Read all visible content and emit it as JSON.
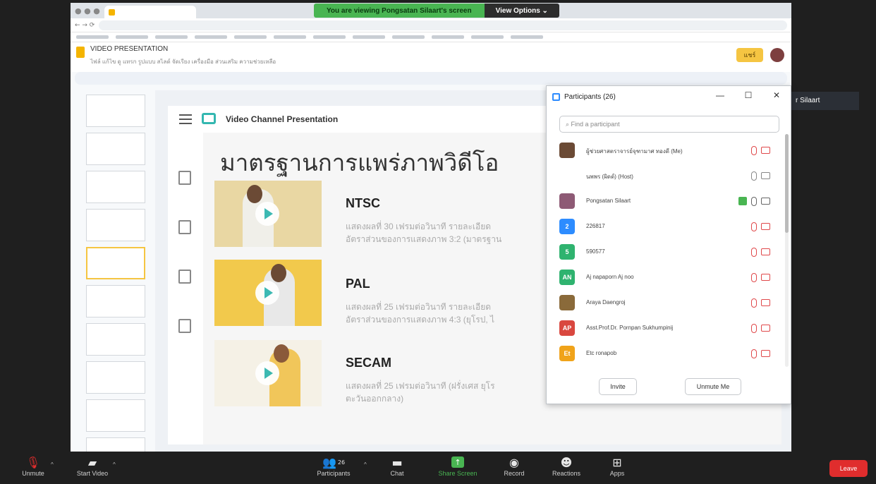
{
  "banner": {
    "sharing_text": "You are viewing Pongsatan Silaart's screen",
    "view_options": "View Options ⌄"
  },
  "doc": {
    "title": "VIDEO PRESENTATION",
    "menus": "ไฟล์  แก้ไข  ดู  แทรก  รูปแบบ  สไลด์  จัดเรียง  เครื่องมือ  ส่วนเสริม  ความช่วยเหลือ",
    "share_label": "แชร์"
  },
  "slide": {
    "channel_title": "Video Channel Presentation",
    "heading": "มาตรฐานการแพร่ภาพวิดีโอ",
    "standards": [
      {
        "name": "NTSC",
        "line1": "แสดงผลที่ 30 เฟรมต่อวินาที รายละเอียด",
        "line2": "อัตราส่วนของการแสดงภาพ 3:2 (มาตรฐาน"
      },
      {
        "name": "PAL",
        "line1": "แสดงผลที่ 25 เฟรมต่อวินาที รายละเอียด",
        "line2": "อัตราส่วนของการแสดงภาพ 4:3 (ยุโรป, ไ"
      },
      {
        "name": "SECAM",
        "line1": "แสดงผลที่ 25 เฟรมต่อวินาที (ฝรั่งเศส ยุโร",
        "line2": "ตะวันออกกลาง)"
      }
    ]
  },
  "participants": {
    "title": "Participants (26)",
    "search_placeholder": "Find a participant",
    "list": [
      {
        "name": "ผู้ช่วยศาสตราจารย์จุฑามาศ ทองดี (Me)",
        "color": "#6b4a35",
        "initials": ""
      },
      {
        "name": "นพพร (ผิดด์) (Host)",
        "color": "#ffffff",
        "initials": ""
      },
      {
        "name": "Pongsatan Silaart",
        "color": "#8e5a75",
        "initials": ""
      },
      {
        "name": "226817",
        "color": "#2d8cff",
        "initials": "2"
      },
      {
        "name": "590577",
        "color": "#2fb36f",
        "initials": "5"
      },
      {
        "name": "Aj napaporn Aj noo",
        "color": "#2fb36f",
        "initials": "AN"
      },
      {
        "name": "Araya Daengroj",
        "color": "#8a6a3a",
        "initials": ""
      },
      {
        "name": "Asst.Prof.Dr. Pornpan Sukhumpinij",
        "color": "#d9473f",
        "initials": "AP"
      },
      {
        "name": "Etc ronapob",
        "color": "#f0a31a",
        "initials": "Et"
      }
    ],
    "invite": "Invite",
    "unmute_me": "Unmute Me"
  },
  "tooltip": "r Silaart",
  "zoom_bar": {
    "unmute": "Unmute",
    "start_video": "Start Video",
    "participants": "Participants",
    "participant_count": "26",
    "chat": "Chat",
    "share_screen": "Share Screen",
    "record": "Record",
    "reactions": "Reactions",
    "apps": "Apps",
    "leave": "Leave"
  }
}
